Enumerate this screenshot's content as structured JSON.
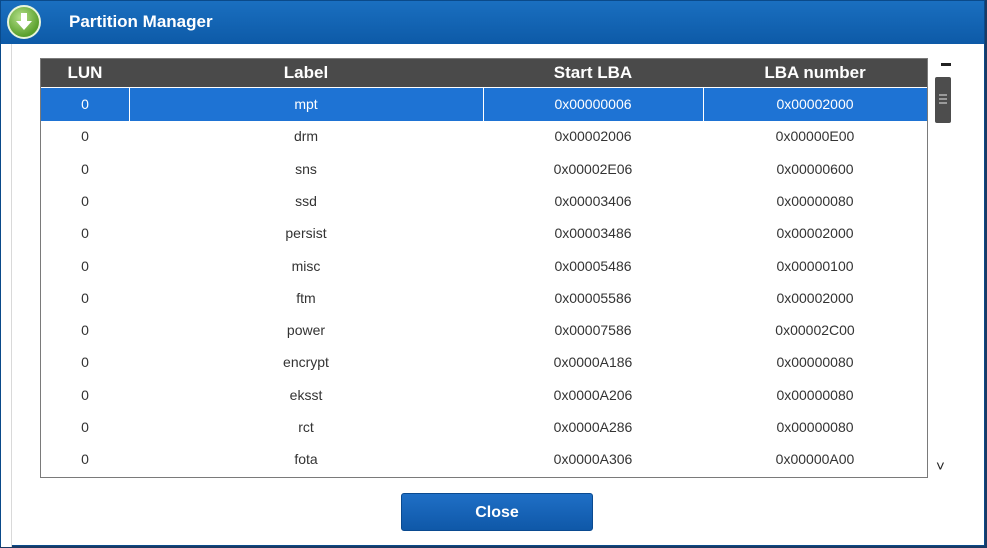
{
  "window": {
    "title": "Partition Manager"
  },
  "table": {
    "columns": [
      "LUN",
      "Label",
      "Start LBA",
      "LBA number"
    ],
    "rows": [
      {
        "lun": "0",
        "label": "mpt",
        "start": "0x00000006",
        "count": "0x00002000"
      },
      {
        "lun": "0",
        "label": "drm",
        "start": "0x00002006",
        "count": "0x00000E00"
      },
      {
        "lun": "0",
        "label": "sns",
        "start": "0x00002E06",
        "count": "0x00000600"
      },
      {
        "lun": "0",
        "label": "ssd",
        "start": "0x00003406",
        "count": "0x00000080"
      },
      {
        "lun": "0",
        "label": "persist",
        "start": "0x00003486",
        "count": "0x00002000"
      },
      {
        "lun": "0",
        "label": "misc",
        "start": "0x00005486",
        "count": "0x00000100"
      },
      {
        "lun": "0",
        "label": "ftm",
        "start": "0x00005586",
        "count": "0x00002000"
      },
      {
        "lun": "0",
        "label": "power",
        "start": "0x00007586",
        "count": "0x00002C00"
      },
      {
        "lun": "0",
        "label": "encrypt",
        "start": "0x0000A186",
        "count": "0x00000080"
      },
      {
        "lun": "0",
        "label": "eksst",
        "start": "0x0000A206",
        "count": "0x00000080"
      },
      {
        "lun": "0",
        "label": "rct",
        "start": "0x0000A286",
        "count": "0x00000080"
      },
      {
        "lun": "0",
        "label": "fota",
        "start": "0x0000A306",
        "count": "0x00000A00"
      }
    ]
  },
  "scroll_down_glyph": "˅",
  "buttons": {
    "close": "Close"
  },
  "colors": {
    "titlebar": "#0d5aa7",
    "selected_row": "#1e73d4",
    "header": "#4a4a4a"
  },
  "icons": {
    "title": "download-arrow-icon"
  }
}
